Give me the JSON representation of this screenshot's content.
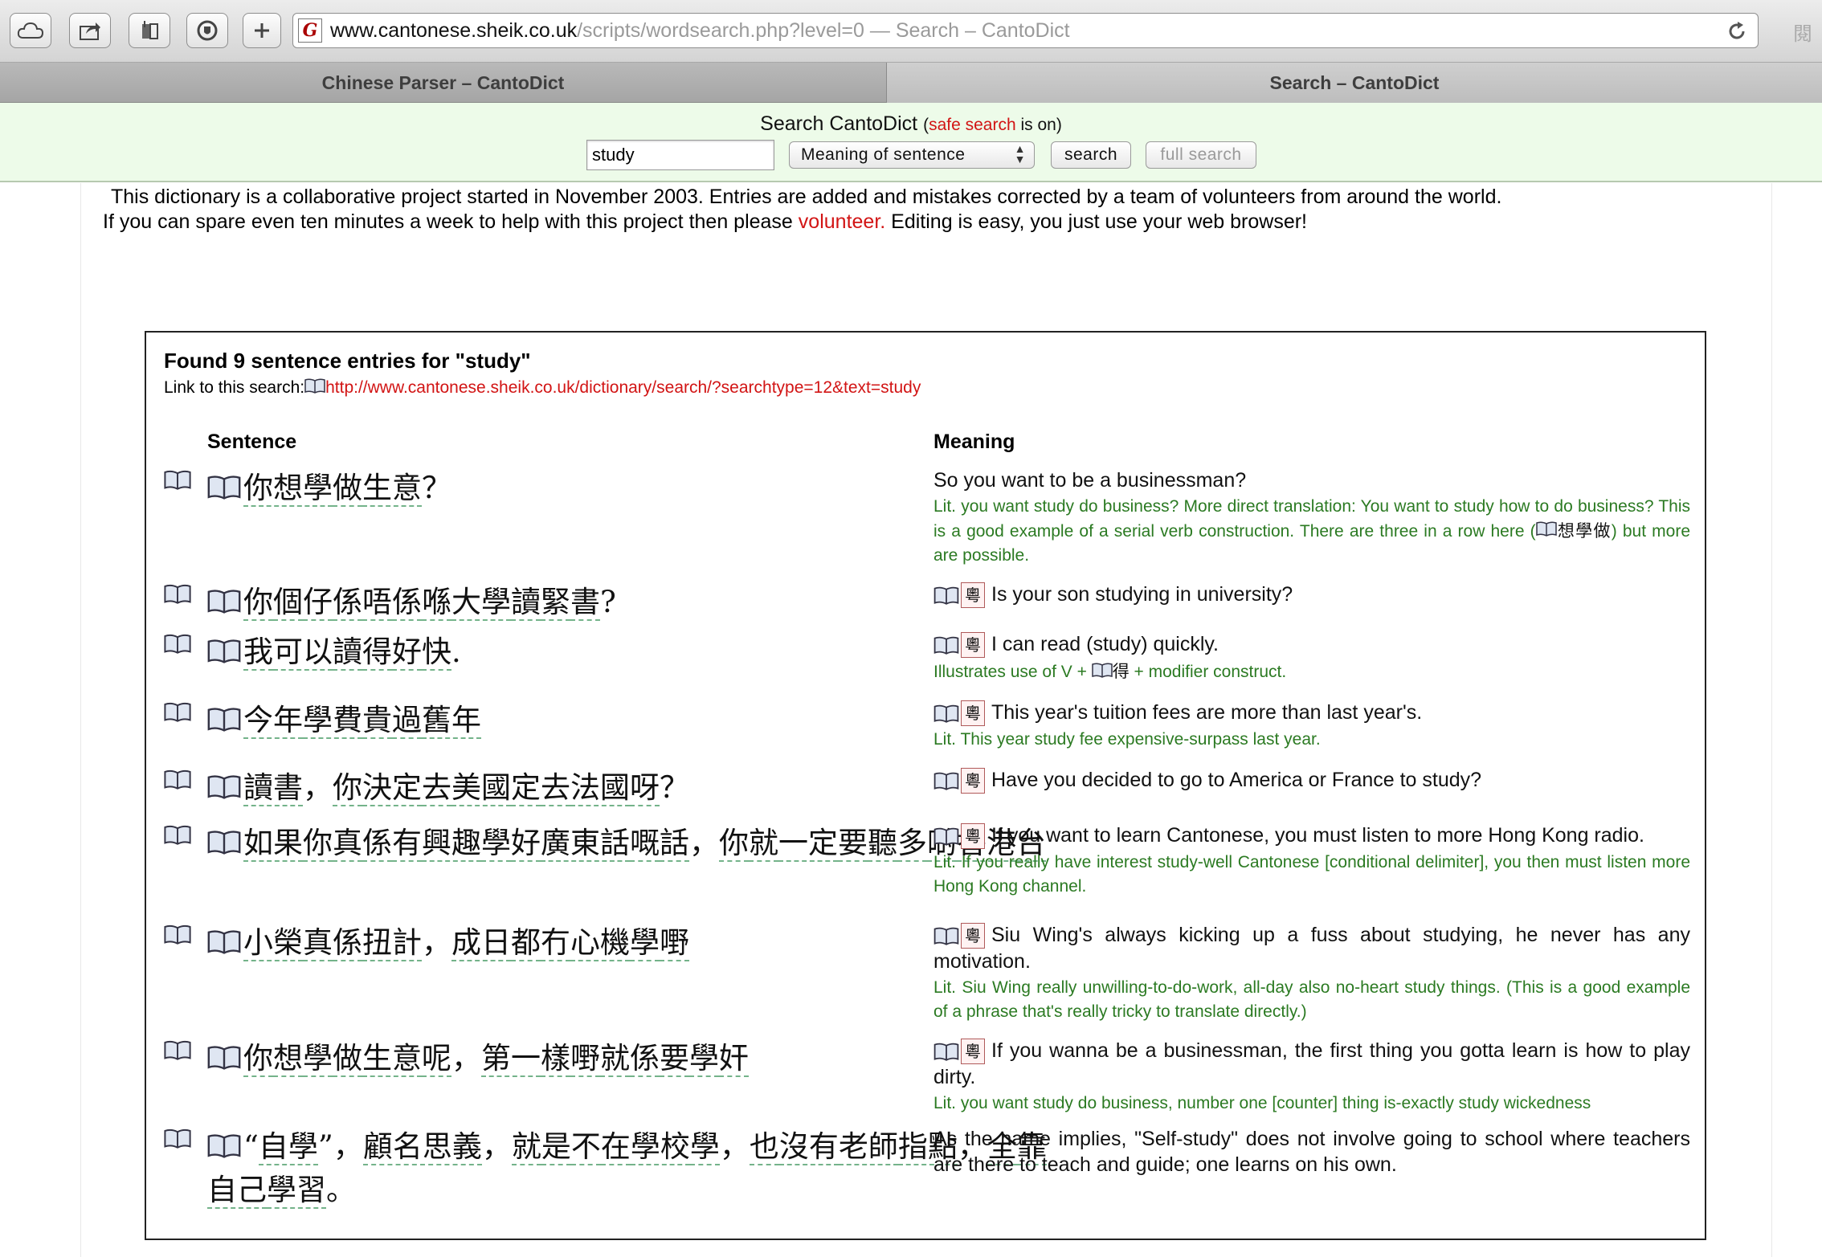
{
  "browser": {
    "address_domain": "www.cantonese.sheik.co.uk",
    "address_rest": "/scripts/wordsearch.php?level=0 — Search – CantoDict",
    "side_glyph": "閱",
    "tabs": [
      {
        "label": "Chinese Parser – CantoDict",
        "active": false
      },
      {
        "label": "Search – CantoDict",
        "active": true
      }
    ]
  },
  "search": {
    "title": "Search CantoDict",
    "safe_open": "(",
    "safe_link": "safe search",
    "safe_close": " is on)",
    "query": "study",
    "mode": "Meaning of sentence",
    "search_label": "search",
    "full_search_label": "full search"
  },
  "intro": {
    "line1": "This dictionary is a collaborative project started in November 2003. Entries are added and mistakes corrected by a team of volunteers from around the world.",
    "line2_pre": "If you can spare even ten minutes a week to help with this project then please ",
    "line2_link": "volunteer.",
    "line2_post": " Editing is easy, you just use your web browser!"
  },
  "results": {
    "found": "Found 9 sentence entries for \"study\"",
    "link_label": "Link to this search: ",
    "link_url": "http://www.cantonese.sheik.co.uk/dictionary/search/?searchtype=12&text=study",
    "col_sentence": "Sentence",
    "col_meaning": "Meaning",
    "yue_char": "粵",
    "rows": [
      {
        "zh_parts": [
          "你想學",
          "做",
          "生意",
          "？"
        ],
        "meaning": "So you want to be a businessman?",
        "lit": "Lit. you want study do business? More direct translation: You want to study how to do business? This is a good example of a serial verb construction. There are three in a row here (",
        "lit_cjk": "想學做",
        "lit_end": ") but more are possible."
      },
      {
        "zh_parts": [
          "你",
          "個",
          "仔",
          "係",
          "唔",
          "係",
          "喺",
          "大學",
          "讀",
          "緊",
          "書",
          "?"
        ],
        "meaning": "Is your son studying in university?"
      },
      {
        "zh_parts": [
          "我",
          "可以",
          "讀",
          "得",
          "好",
          "快",
          "."
        ],
        "meaning": "I can read (study) quickly.",
        "lit": "Illustrates use of V + ",
        "lit_cjk": "得",
        "lit_end": " + modifier construct."
      },
      {
        "zh_parts": [
          "今年",
          "學費",
          "貴",
          "過",
          "舊年"
        ],
        "meaning": "This year's tuition fees are more than last year's.",
        "lit": "Lit. This year study fee expensive-surpass last year."
      },
      {
        "zh_parts": [
          "讀書",
          "，",
          "你",
          "決定",
          "去",
          "美國",
          "定",
          "去",
          "法國",
          "呀",
          "？"
        ],
        "meaning": "Have you decided to go to America or France to study?"
      },
      {
        "zh_parts": [
          "如果",
          "你",
          "真",
          "係",
          "有",
          "興趣",
          "學",
          "好",
          "廣東話",
          "嘅",
          "話",
          "，",
          "你",
          "就",
          "一定",
          "要",
          "聽",
          "多",
          "啲",
          "香港",
          "台"
        ],
        "meaning": "If you want to learn Cantonese, you must listen to more Hong Kong radio.",
        "lit": "Lit. If you really have interest study-well Cantonese [conditional delimiter], you then must listen more Hong Kong channel."
      },
      {
        "zh_parts": [
          "小榮",
          "真",
          "係",
          "扭計",
          "，",
          "成日",
          "都",
          "冇",
          "心機",
          "學",
          "嘢"
        ],
        "meaning": "Siu Wing's always kicking up a fuss about studying, he never has any motivation.",
        "lit": "Lit. Siu Wing really unwilling-to-do-work, all-day also no-heart study things. (This is a good example of a phrase that's really tricky to translate directly.)"
      },
      {
        "zh_parts": [
          "你",
          "想",
          "學",
          "做",
          "生意",
          "呢",
          "，",
          "第一",
          "樣",
          "嘢",
          "就",
          "係",
          "要",
          "學",
          "奸"
        ],
        "meaning": "If you wanna be a businessman, the first thing you gotta learn is how to play dirty.",
        "lit": "Lit. you want study do business, number one [counter] thing is-exactly study wickedness"
      },
      {
        "zh_parts": [
          "“",
          "自學",
          "”，",
          "顧名思義",
          "，",
          "就",
          "是",
          "不",
          "在",
          "學校",
          "學",
          "，",
          "也",
          "沒有",
          "老師",
          "指點",
          "，",
          "全",
          "靠",
          "自己",
          "學習",
          "。"
        ],
        "meaning": "As the name implies, \"Self-study\" does not involve going to school where teachers are there to teach and guide; one learns on his own."
      }
    ]
  }
}
